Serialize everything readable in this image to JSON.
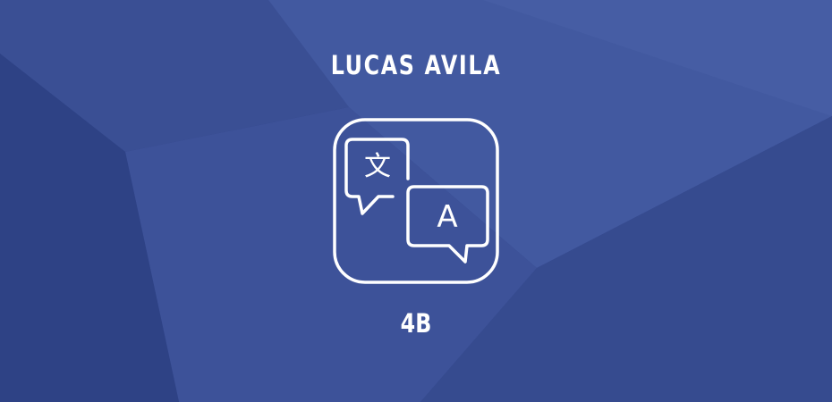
{
  "card": {
    "title": "LUCAS AVILA",
    "code": "4B",
    "icon": "translate-icon",
    "glyph_source": "文",
    "glyph_target": "A"
  },
  "colors": {
    "background": "#33478a",
    "foreground": "#ffffff"
  }
}
